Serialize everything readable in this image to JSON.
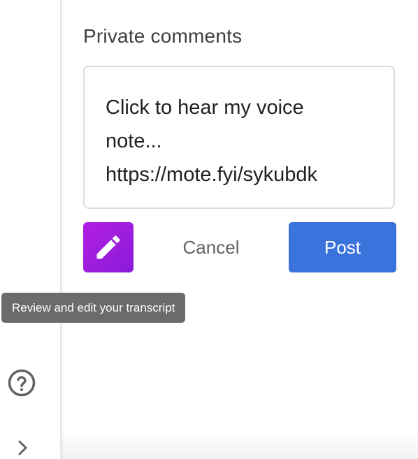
{
  "comments": {
    "title": "Private comments",
    "text": "Click to hear my voice\nnote...\nhttps://mote.fyi/sykubdk"
  },
  "actions": {
    "mote_icon": "pencil-icon",
    "mote_color": "#a21fdd",
    "cancel_label": "Cancel",
    "post_label": "Post",
    "post_color": "#3b73dd"
  },
  "tooltip": {
    "text": "Review and edit your transcript"
  },
  "sidebar": {
    "help_icon": "help-circle-icon",
    "expand_icon": "chevron-right-icon"
  }
}
